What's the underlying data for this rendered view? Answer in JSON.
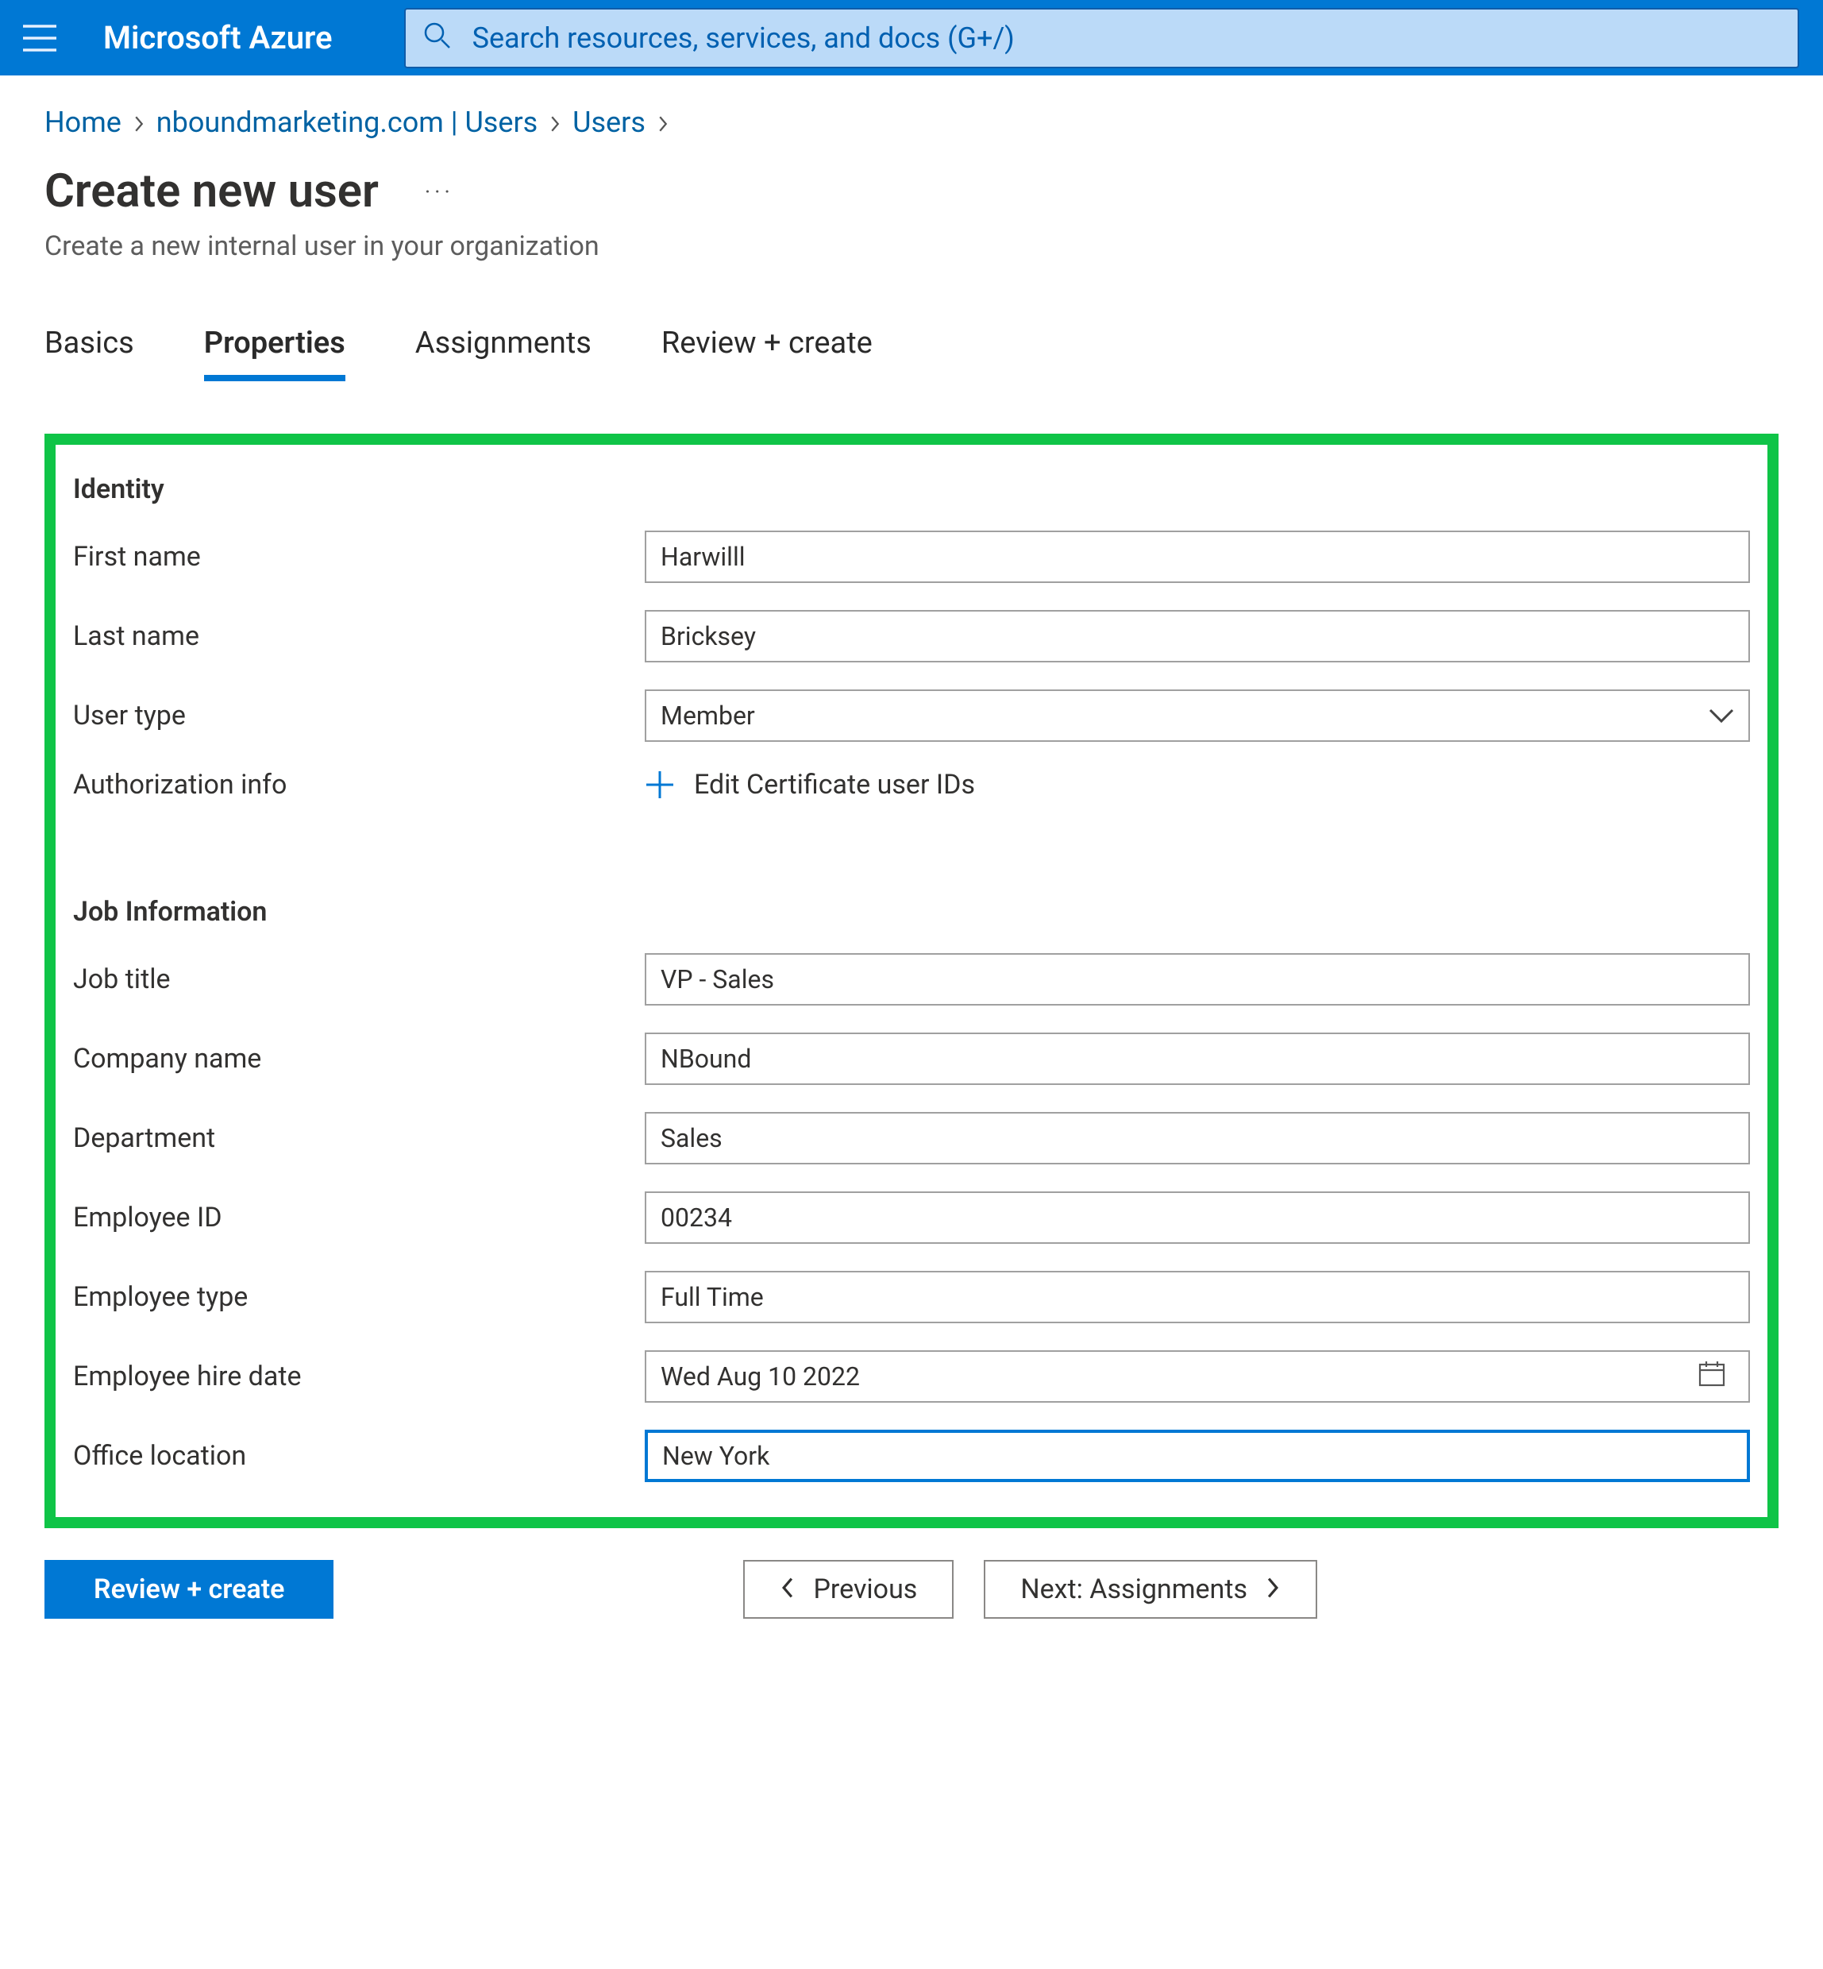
{
  "header": {
    "brand": "Microsoft Azure",
    "search_placeholder": "Search resources, services, and docs (G+/)"
  },
  "breadcrumb": {
    "items": [
      "Home",
      "nboundmarketing.com | Users",
      "Users"
    ]
  },
  "page": {
    "title": "Create new user",
    "subtitle": "Create a new internal user in your organization"
  },
  "tabs": {
    "items": [
      "Basics",
      "Properties",
      "Assignments",
      "Review + create"
    ],
    "selected_index": 1
  },
  "sections": {
    "identity": {
      "heading": "Identity",
      "first_name_label": "First name",
      "first_name_value": "Harwilll",
      "last_name_label": "Last name",
      "last_name_value": "Bricksey",
      "user_type_label": "User type",
      "user_type_value": "Member",
      "auth_info_label": "Authorization info",
      "edit_cert_label": "Edit Certificate user IDs"
    },
    "job": {
      "heading": "Job Information",
      "job_title_label": "Job title",
      "job_title_value": "VP - Sales",
      "company_label": "Company name",
      "company_value": "NBound",
      "department_label": "Department",
      "department_value": "Sales",
      "emp_id_label": "Employee ID",
      "emp_id_value": "00234",
      "emp_type_label": "Employee type",
      "emp_type_value": "Full Time",
      "hire_date_label": "Employee hire date",
      "hire_date_value": "Wed Aug 10 2022",
      "office_label": "Office location",
      "office_value": "New York"
    }
  },
  "footer": {
    "review_create": "Review + create",
    "previous": "Previous",
    "next": "Next: Assignments"
  }
}
